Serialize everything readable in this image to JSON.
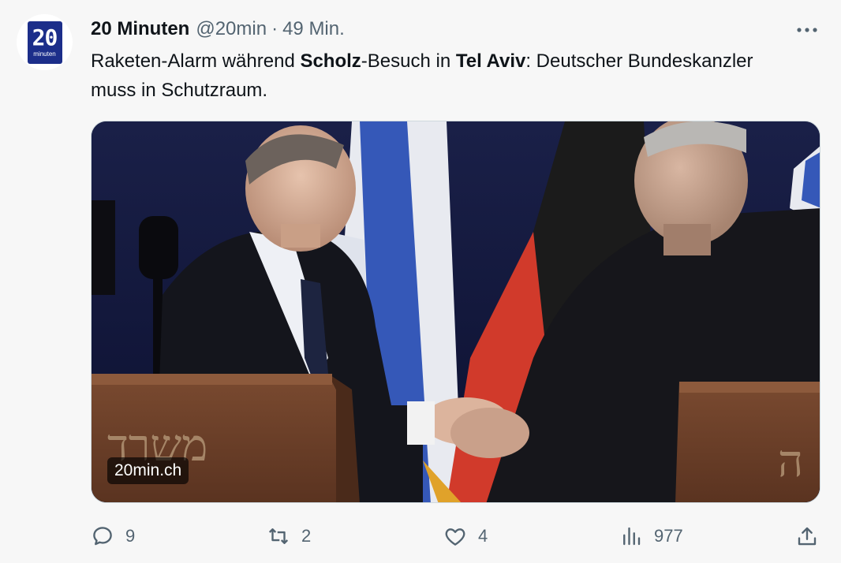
{
  "author": {
    "avatar_logo": {
      "number": "20",
      "word": "minuten"
    },
    "name": "20 Minuten",
    "handle": "@20min",
    "separator": "·",
    "time": "49 Min."
  },
  "more_icon": "more-icon",
  "tweet": {
    "text_parts": [
      {
        "text": "Raketen-Alarm während ",
        "bold": false
      },
      {
        "text": "Scholz",
        "bold": true
      },
      {
        "text": "-Besuch in ",
        "bold": false
      },
      {
        "text": "Tel Aviv",
        "bold": true
      },
      {
        "text": ": Deutscher Bundeskanzler muss in Schutzraum.",
        "bold": false
      }
    ]
  },
  "media": {
    "source_badge": "20min.ch",
    "podium_left_text": "משרד",
    "podium_right_text": "ה"
  },
  "actions": {
    "replies": "9",
    "reposts": "2",
    "likes": "4",
    "views": "977"
  },
  "colors": {
    "text_primary": "#0f1419",
    "text_secondary": "#536471",
    "logo_blue": "#1c2e8a",
    "background": "#f7f7f7"
  }
}
